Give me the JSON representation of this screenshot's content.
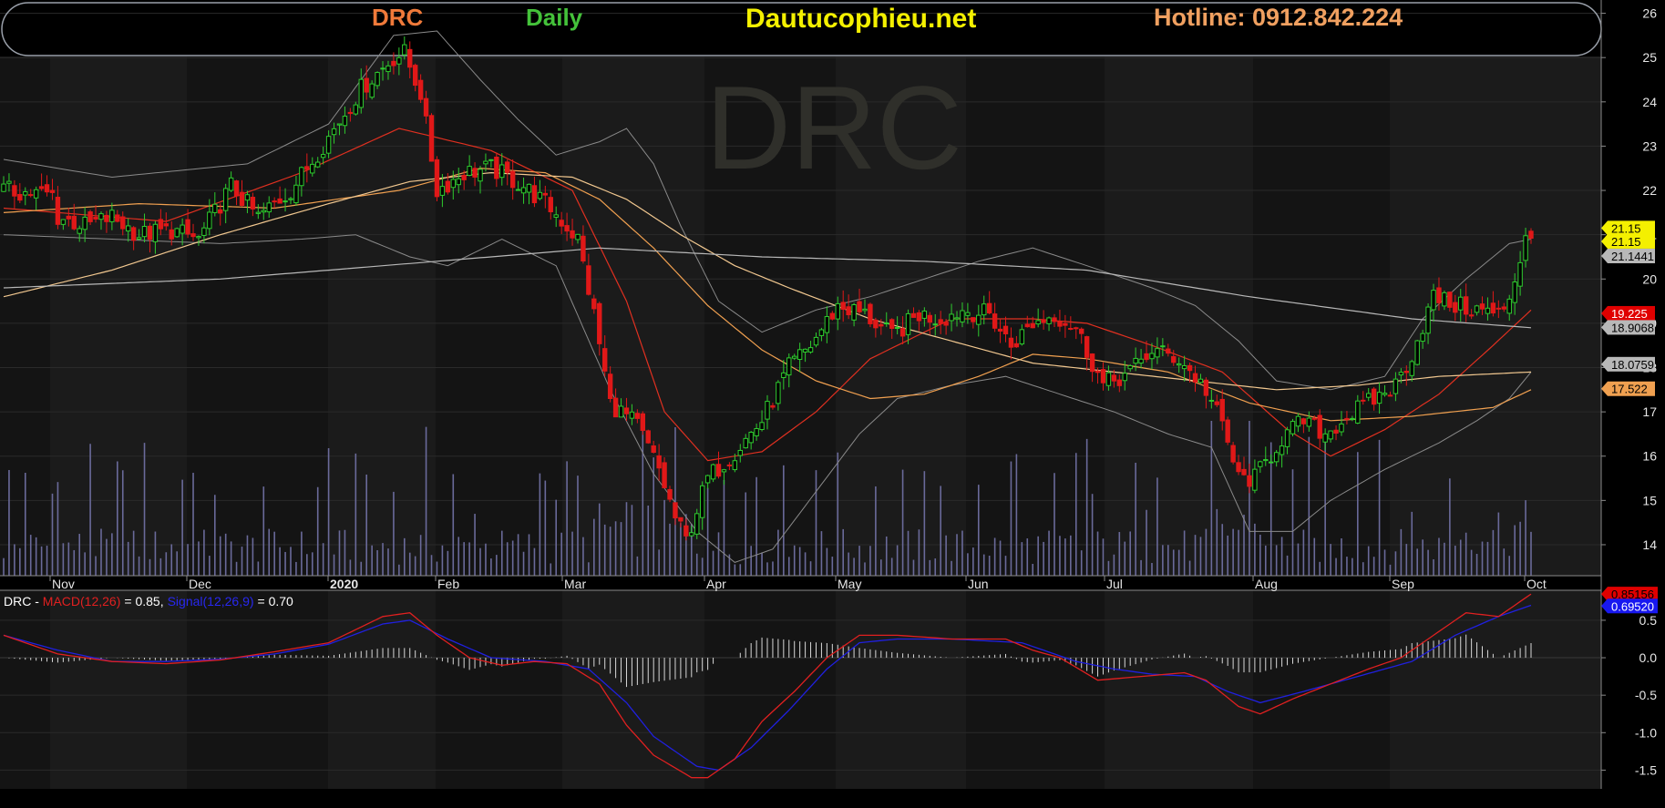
{
  "header": {
    "symbol": "DRC",
    "period": "Daily",
    "site": "Dautucophieu.net",
    "hotline": "Hotline: 0912.842.224",
    "colors": {
      "symbol": "#f07a3a",
      "period": "#44c23a",
      "site": "#f4f000",
      "hotline": "#f0a060"
    }
  },
  "watermark": "DRC",
  "chart_data": [
    {
      "type": "candlestick",
      "title": "DRC",
      "x_months": [
        "Nov",
        "Dec",
        "2020",
        "Feb",
        "Mar",
        "Apr",
        "May",
        "Jun",
        "Jul",
        "Aug",
        "Sep",
        "Oct"
      ],
      "y_ticks": [
        14,
        15,
        16,
        17,
        18,
        19,
        20,
        21,
        22,
        23,
        24,
        25,
        26
      ],
      "ylim": [
        13.3,
        26.3
      ],
      "price_path": [
        [
          0,
          22.0
        ],
        [
          9,
          21.9
        ],
        [
          10,
          21.4
        ],
        [
          15,
          21.2
        ],
        [
          20,
          21.4
        ],
        [
          25,
          21.0
        ],
        [
          31,
          21.1
        ],
        [
          36,
          20.9
        ],
        [
          42,
          22.1
        ],
        [
          47,
          21.4
        ],
        [
          53,
          22.0
        ],
        [
          60,
          23.2
        ],
        [
          66,
          24.3
        ],
        [
          72,
          25.0
        ],
        [
          74,
          25.1
        ],
        [
          77,
          24.2
        ],
        [
          80,
          22.0
        ],
        [
          85,
          22.4
        ],
        [
          90,
          22.5
        ],
        [
          96,
          22.1
        ],
        [
          101,
          21.6
        ],
        [
          106,
          20.9
        ],
        [
          109,
          19.2
        ],
        [
          112,
          17.2
        ],
        [
          117,
          16.7
        ],
        [
          121,
          15.7
        ],
        [
          124,
          14.6
        ],
        [
          126,
          14.1
        ],
        [
          130,
          15.5
        ],
        [
          135,
          16.1
        ],
        [
          140,
          16.8
        ],
        [
          145,
          18.0
        ],
        [
          149,
          18.5
        ],
        [
          154,
          19.4
        ],
        [
          159,
          19.2
        ],
        [
          164,
          18.7
        ],
        [
          169,
          19.2
        ],
        [
          173,
          19.1
        ],
        [
          177,
          19.3
        ],
        [
          182,
          19.2
        ],
        [
          186,
          18.5
        ],
        [
          190,
          19.0
        ],
        [
          194,
          19.2
        ],
        [
          198,
          18.9
        ],
        [
          203,
          17.6
        ],
        [
          208,
          17.9
        ],
        [
          212,
          18.4
        ],
        [
          217,
          18.2
        ],
        [
          222,
          17.5
        ],
        [
          225,
          16.7
        ],
        [
          228,
          15.5
        ],
        [
          231,
          15.5
        ],
        [
          236,
          16.4
        ],
        [
          240,
          16.8
        ],
        [
          244,
          16.5
        ],
        [
          248,
          16.9
        ],
        [
          252,
          17.2
        ],
        [
          257,
          17.6
        ],
        [
          260,
          18.3
        ],
        [
          264,
          19.6
        ],
        [
          268,
          19.4
        ],
        [
          272,
          19.3
        ],
        [
          277,
          19.2
        ],
        [
          279,
          20.0
        ],
        [
          281,
          21.0
        ]
      ],
      "moving_averages": [
        {
          "color": "#e03020",
          "points": [
            [
              0,
              21.6
            ],
            [
              30,
              21.3
            ],
            [
              55,
              22.4
            ],
            [
              73,
              23.4
            ],
            [
              90,
              22.9
            ],
            [
              105,
              22.0
            ],
            [
              115,
              19.5
            ],
            [
              122,
              17.0
            ],
            [
              130,
              15.9
            ],
            [
              140,
              16.1
            ],
            [
              150,
              17.0
            ],
            [
              160,
              18.2
            ],
            [
              175,
              19.1
            ],
            [
              190,
              19.1
            ],
            [
              200,
              19.0
            ],
            [
              212,
              18.5
            ],
            [
              225,
              17.9
            ],
            [
              237,
              16.6
            ],
            [
              245,
              16.0
            ],
            [
              255,
              16.6
            ],
            [
              265,
              17.4
            ],
            [
              275,
              18.5
            ],
            [
              282,
              19.3
            ]
          ]
        },
        {
          "color": "#f0a050",
          "points": [
            [
              0,
              21.5
            ],
            [
              25,
              21.7
            ],
            [
              50,
              21.6
            ],
            [
              73,
              22.0
            ],
            [
              88,
              22.5
            ],
            [
              100,
              22.4
            ],
            [
              110,
              21.8
            ],
            [
              120,
              20.7
            ],
            [
              130,
              19.4
            ],
            [
              140,
              18.4
            ],
            [
              150,
              17.7
            ],
            [
              160,
              17.3
            ],
            [
              170,
              17.4
            ],
            [
              180,
              17.8
            ],
            [
              190,
              18.3
            ],
            [
              200,
              18.2
            ],
            [
              215,
              17.9
            ],
            [
              230,
              17.2
            ],
            [
              245,
              16.8
            ],
            [
              260,
              16.9
            ],
            [
              275,
              17.1
            ],
            [
              282,
              17.5
            ]
          ]
        },
        {
          "color": "#f2c890",
          "points": [
            [
              0,
              19.6
            ],
            [
              20,
              20.2
            ],
            [
              40,
              21.0
            ],
            [
              60,
              21.7
            ],
            [
              75,
              22.2
            ],
            [
              90,
              22.4
            ],
            [
              105,
              22.3
            ],
            [
              115,
              21.8
            ],
            [
              125,
              21.0
            ],
            [
              135,
              20.3
            ],
            [
              145,
              19.8
            ],
            [
              160,
              19.1
            ],
            [
              175,
              18.6
            ],
            [
              190,
              18.1
            ],
            [
              205,
              17.9
            ],
            [
              220,
              17.7
            ],
            [
              235,
              17.5
            ],
            [
              250,
              17.6
            ],
            [
              265,
              17.8
            ],
            [
              282,
              17.9
            ]
          ]
        },
        {
          "color": "#b8b8b8",
          "points": [
            [
              0,
              19.8
            ],
            [
              40,
              20.0
            ],
            [
              80,
              20.4
            ],
            [
              110,
              20.7
            ],
            [
              140,
              20.5
            ],
            [
              170,
              20.4
            ],
            [
              200,
              20.2
            ],
            [
              230,
              19.6
            ],
            [
              260,
              19.1
            ],
            [
              282,
              18.9
            ]
          ]
        }
      ],
      "bollinger_upper": [
        [
          0,
          22.7
        ],
        [
          20,
          22.3
        ],
        [
          45,
          22.6
        ],
        [
          60,
          23.5
        ],
        [
          72,
          25.5
        ],
        [
          80,
          25.6
        ],
        [
          88,
          24.5
        ],
        [
          95,
          23.6
        ],
        [
          102,
          22.8
        ],
        [
          110,
          23.1
        ],
        [
          115,
          23.4
        ],
        [
          120,
          22.6
        ],
        [
          125,
          21.2
        ],
        [
          132,
          19.5
        ],
        [
          140,
          18.8
        ],
        [
          150,
          19.3
        ],
        [
          160,
          19.6
        ],
        [
          170,
          20.0
        ],
        [
          180,
          20.4
        ],
        [
          190,
          20.7
        ],
        [
          200,
          20.3
        ],
        [
          212,
          19.8
        ],
        [
          220,
          19.4
        ],
        [
          228,
          18.6
        ],
        [
          235,
          17.7
        ],
        [
          245,
          17.5
        ],
        [
          255,
          17.8
        ],
        [
          262,
          19.1
        ],
        [
          270,
          20.0
        ],
        [
          278,
          20.8
        ],
        [
          282,
          20.9
        ]
      ],
      "bollinger_lower": [
        [
          0,
          21.0
        ],
        [
          20,
          20.9
        ],
        [
          40,
          20.8
        ],
        [
          55,
          20.9
        ],
        [
          65,
          21.0
        ],
        [
          75,
          20.5
        ],
        [
          82,
          20.3
        ],
        [
          92,
          20.9
        ],
        [
          102,
          20.3
        ],
        [
          112,
          17.5
        ],
        [
          120,
          15.6
        ],
        [
          128,
          14.3
        ],
        [
          135,
          13.6
        ],
        [
          142,
          13.9
        ],
        [
          150,
          15.2
        ],
        [
          158,
          16.5
        ],
        [
          165,
          17.3
        ],
        [
          175,
          17.6
        ],
        [
          185,
          17.8
        ],
        [
          195,
          17.4
        ],
        [
          205,
          17.0
        ],
        [
          215,
          16.5
        ],
        [
          223,
          16.2
        ],
        [
          230,
          14.3
        ],
        [
          238,
          14.3
        ],
        [
          245,
          15.0
        ],
        [
          255,
          15.7
        ],
        [
          265,
          16.3
        ],
        [
          272,
          16.8
        ],
        [
          278,
          17.3
        ],
        [
          282,
          17.9
        ]
      ],
      "price_labels": [
        {
          "text": "21.15",
          "bg": "#f4f000",
          "fg": "#000000",
          "value": 21.15
        },
        {
          "text": "21.15",
          "bg": "#f4f000",
          "fg": "#000000",
          "value": 20.85
        },
        {
          "text": "21.1441",
          "bg": "#b8b8b8",
          "fg": "#000000",
          "value": 20.52
        },
        {
          "text": "19.225",
          "bg": "#e00000",
          "fg": "#ffffff",
          "value": 19.225
        },
        {
          "text": "18.9068",
          "bg": "#b8b8b8",
          "fg": "#000000",
          "value": 18.9068
        },
        {
          "text": "18.0759",
          "bg": "#b8b8b8",
          "fg": "#000000",
          "value": 18.0759
        },
        {
          "text": "17.522",
          "bg": "#f0a050",
          "fg": "#000000",
          "value": 17.522
        }
      ]
    },
    {
      "type": "line",
      "title": "DRC - MACD(12,26) = 0.85, Signal(12,26,9) = 0.70",
      "legend": {
        "prefix": "DRC - ",
        "macd_label": "MACD(12,26)",
        "macd_value": "= 0.85,",
        "signal_label": "Signal(12,26,9)",
        "signal_value": "= 0.70"
      },
      "y_ticks": [
        0.5,
        0.0,
        -0.5,
        -1.0,
        -1.5
      ],
      "ylim": [
        -1.75,
        0.9
      ],
      "series": [
        {
          "name": "MACD(12,26)",
          "color": "#e02020",
          "points": [
            [
              0,
              0.3
            ],
            [
              10,
              0.05
            ],
            [
              20,
              -0.05
            ],
            [
              30,
              -0.08
            ],
            [
              40,
              -0.03
            ],
            [
              50,
              0.08
            ],
            [
              60,
              0.2
            ],
            [
              70,
              0.55
            ],
            [
              75,
              0.6
            ],
            [
              80,
              0.3
            ],
            [
              86,
              0.0
            ],
            [
              92,
              -0.1
            ],
            [
              98,
              -0.05
            ],
            [
              104,
              -0.08
            ],
            [
              110,
              -0.35
            ],
            [
              115,
              -0.9
            ],
            [
              120,
              -1.3
            ],
            [
              127,
              -1.6
            ],
            [
              130,
              -1.6
            ],
            [
              135,
              -1.35
            ],
            [
              140,
              -0.85
            ],
            [
              146,
              -0.45
            ],
            [
              152,
              0.0
            ],
            [
              158,
              0.3
            ],
            [
              165,
              0.3
            ],
            [
              175,
              0.25
            ],
            [
              185,
              0.25
            ],
            [
              190,
              0.1
            ],
            [
              195,
              0.0
            ],
            [
              202,
              -0.3
            ],
            [
              210,
              -0.25
            ],
            [
              218,
              -0.2
            ],
            [
              222,
              -0.3
            ],
            [
              228,
              -0.65
            ],
            [
              232,
              -0.75
            ],
            [
              238,
              -0.55
            ],
            [
              245,
              -0.35
            ],
            [
              252,
              -0.15
            ],
            [
              258,
              0.0
            ],
            [
              265,
              0.35
            ],
            [
              270,
              0.6
            ],
            [
              276,
              0.55
            ],
            [
              282,
              0.85
            ]
          ]
        },
        {
          "name": "Signal(12,26,9)",
          "color": "#2020e0",
          "points": [
            [
              0,
              0.3
            ],
            [
              10,
              0.1
            ],
            [
              20,
              -0.05
            ],
            [
              30,
              -0.05
            ],
            [
              40,
              -0.02
            ],
            [
              50,
              0.05
            ],
            [
              60,
              0.18
            ],
            [
              70,
              0.45
            ],
            [
              75,
              0.5
            ],
            [
              82,
              0.25
            ],
            [
              90,
              0.0
            ],
            [
              100,
              -0.05
            ],
            [
              108,
              -0.15
            ],
            [
              115,
              -0.6
            ],
            [
              120,
              -1.05
            ],
            [
              128,
              -1.45
            ],
            [
              132,
              -1.5
            ],
            [
              138,
              -1.2
            ],
            [
              145,
              -0.7
            ],
            [
              152,
              -0.15
            ],
            [
              158,
              0.2
            ],
            [
              165,
              0.25
            ],
            [
              175,
              0.25
            ],
            [
              188,
              0.2
            ],
            [
              198,
              -0.05
            ],
            [
              205,
              -0.15
            ],
            [
              212,
              -0.22
            ],
            [
              220,
              -0.25
            ],
            [
              226,
              -0.45
            ],
            [
              232,
              -0.6
            ],
            [
              240,
              -0.45
            ],
            [
              250,
              -0.25
            ],
            [
              260,
              -0.05
            ],
            [
              268,
              0.3
            ],
            [
              276,
              0.55
            ],
            [
              282,
              0.7
            ]
          ]
        }
      ],
      "value_labels": [
        {
          "text": "0.85156",
          "bg": "#e00000",
          "fg": "#000000",
          "value": 0.85
        },
        {
          "text": "0.69520",
          "bg": "#1818f0",
          "fg": "#ffffff",
          "value": 0.69
        }
      ]
    }
  ]
}
